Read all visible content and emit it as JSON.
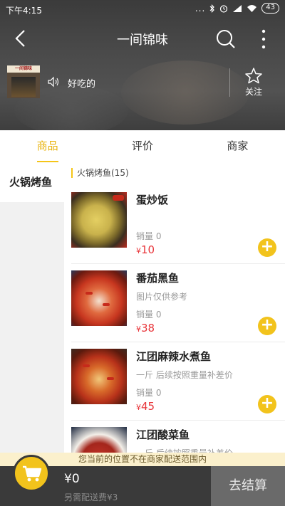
{
  "status": {
    "time": "下午4:15",
    "signal": "...",
    "battery": "43"
  },
  "nav": {
    "title": "一间锦味"
  },
  "store": {
    "logo_text": "一间锦味",
    "notice": "好吃的",
    "follow_label": "关注"
  },
  "tabs": [
    {
      "label": "商品"
    },
    {
      "label": "评价"
    },
    {
      "label": "商家"
    }
  ],
  "categories": [
    {
      "label": "火锅烤鱼"
    }
  ],
  "list": {
    "header": "火锅烤鱼(15)",
    "items": [
      {
        "name": "蛋炒饭",
        "desc": "",
        "sales": "销量 0",
        "currency": "¥",
        "price": "10",
        "image": "fried-rice"
      },
      {
        "name": "番茄黑鱼",
        "desc": "图片仅供参考",
        "sales": "销量 0",
        "currency": "¥",
        "price": "38",
        "image": "tomato-fish"
      },
      {
        "name": "江团麻辣水煮鱼",
        "desc": "一斤  后续按照重量补差价",
        "sales": "销量 0",
        "currency": "¥",
        "price": "45",
        "image": "boiled-fish"
      },
      {
        "name": "江团酸菜鱼",
        "desc": "一斤  后续按照重量补差价",
        "sales": "",
        "currency": "",
        "price": "",
        "image": "pickled-fish"
      }
    ],
    "add_symbol": "+"
  },
  "delivery_notice": "您当前的位置不在商家配送范围内",
  "cart": {
    "total": "¥0",
    "fee_note": "另需配送费¥3",
    "checkout_label": "去结算"
  },
  "colors": {
    "accent": "#f2c31c",
    "price": "#e8353a",
    "cartbar": "#3a3a3a"
  }
}
